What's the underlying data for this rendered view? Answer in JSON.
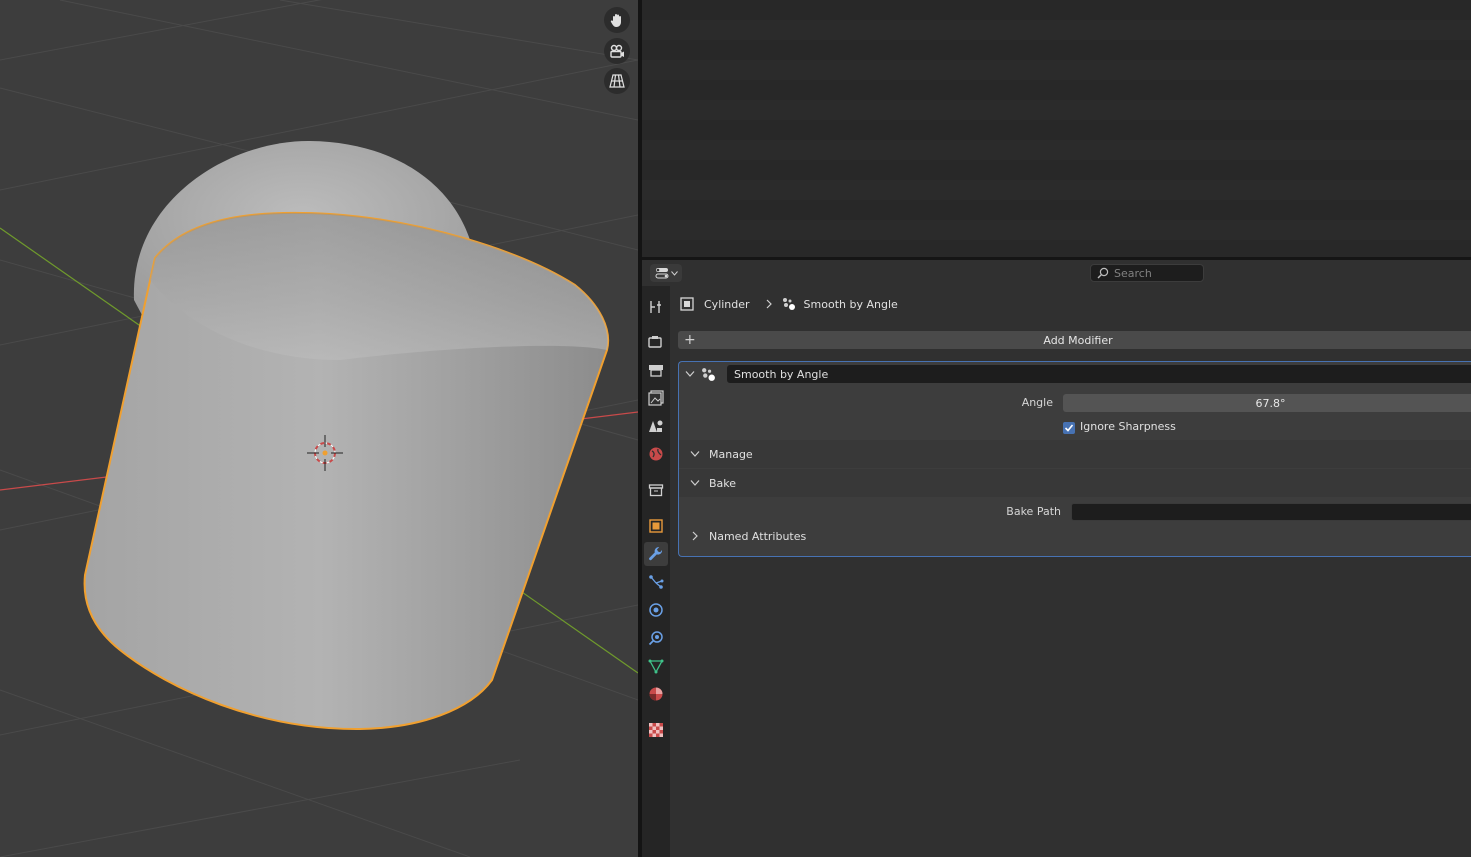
{
  "viewport": {
    "nav_icons": [
      "hand-pan-icon",
      "camera-view-icon",
      "grid-perspective-icon"
    ]
  },
  "properties": {
    "header": {
      "editor_type_icon": "properties-editor-icon",
      "search_placeholder": "Search"
    },
    "tabs": [
      {
        "name": "tool",
        "icon": "tool-icon",
        "active": false
      },
      {
        "name": "render",
        "icon": "render-icon",
        "active": false
      },
      {
        "name": "output",
        "icon": "output-icon",
        "active": false
      },
      {
        "name": "view-layer",
        "icon": "view-layer-icon",
        "active": false
      },
      {
        "name": "scene",
        "icon": "scene-icon",
        "active": false
      },
      {
        "name": "world",
        "icon": "world-icon",
        "active": false
      },
      {
        "name": "collection",
        "icon": "collection-icon",
        "active": false
      },
      {
        "name": "object",
        "icon": "object-icon",
        "active": false
      },
      {
        "name": "modifiers",
        "icon": "wrench-icon",
        "active": true
      },
      {
        "name": "particles",
        "icon": "particles-icon",
        "active": false
      },
      {
        "name": "physics",
        "icon": "physics-icon",
        "active": false
      },
      {
        "name": "constraints",
        "icon": "constraints-icon",
        "active": false
      },
      {
        "name": "data",
        "icon": "mesh-data-icon",
        "active": false
      },
      {
        "name": "material",
        "icon": "material-icon",
        "active": false
      },
      {
        "name": "texture",
        "icon": "texture-icon",
        "active": false
      }
    ],
    "breadcrumb": {
      "object": "Cylinder",
      "modifier": "Smooth by Angle"
    },
    "add_modifier_label": "Add Modifier",
    "modifier": {
      "name": "Smooth by Angle",
      "angle_label": "Angle",
      "angle_value": "67.8°",
      "ignore_sharpness_label": "Ignore Sharpness",
      "ignore_sharpness_checked": true,
      "subpanels": {
        "manage": "Manage",
        "bake": "Bake",
        "bake_path_label": "Bake Path",
        "bake_path_value": "",
        "named_attributes": "Named Attributes"
      }
    }
  },
  "colors": {
    "accent": "#4772b3",
    "selection_outline": "#f0a030",
    "x_axis": "#c94a4a",
    "y_axis": "#6f9a2c"
  }
}
